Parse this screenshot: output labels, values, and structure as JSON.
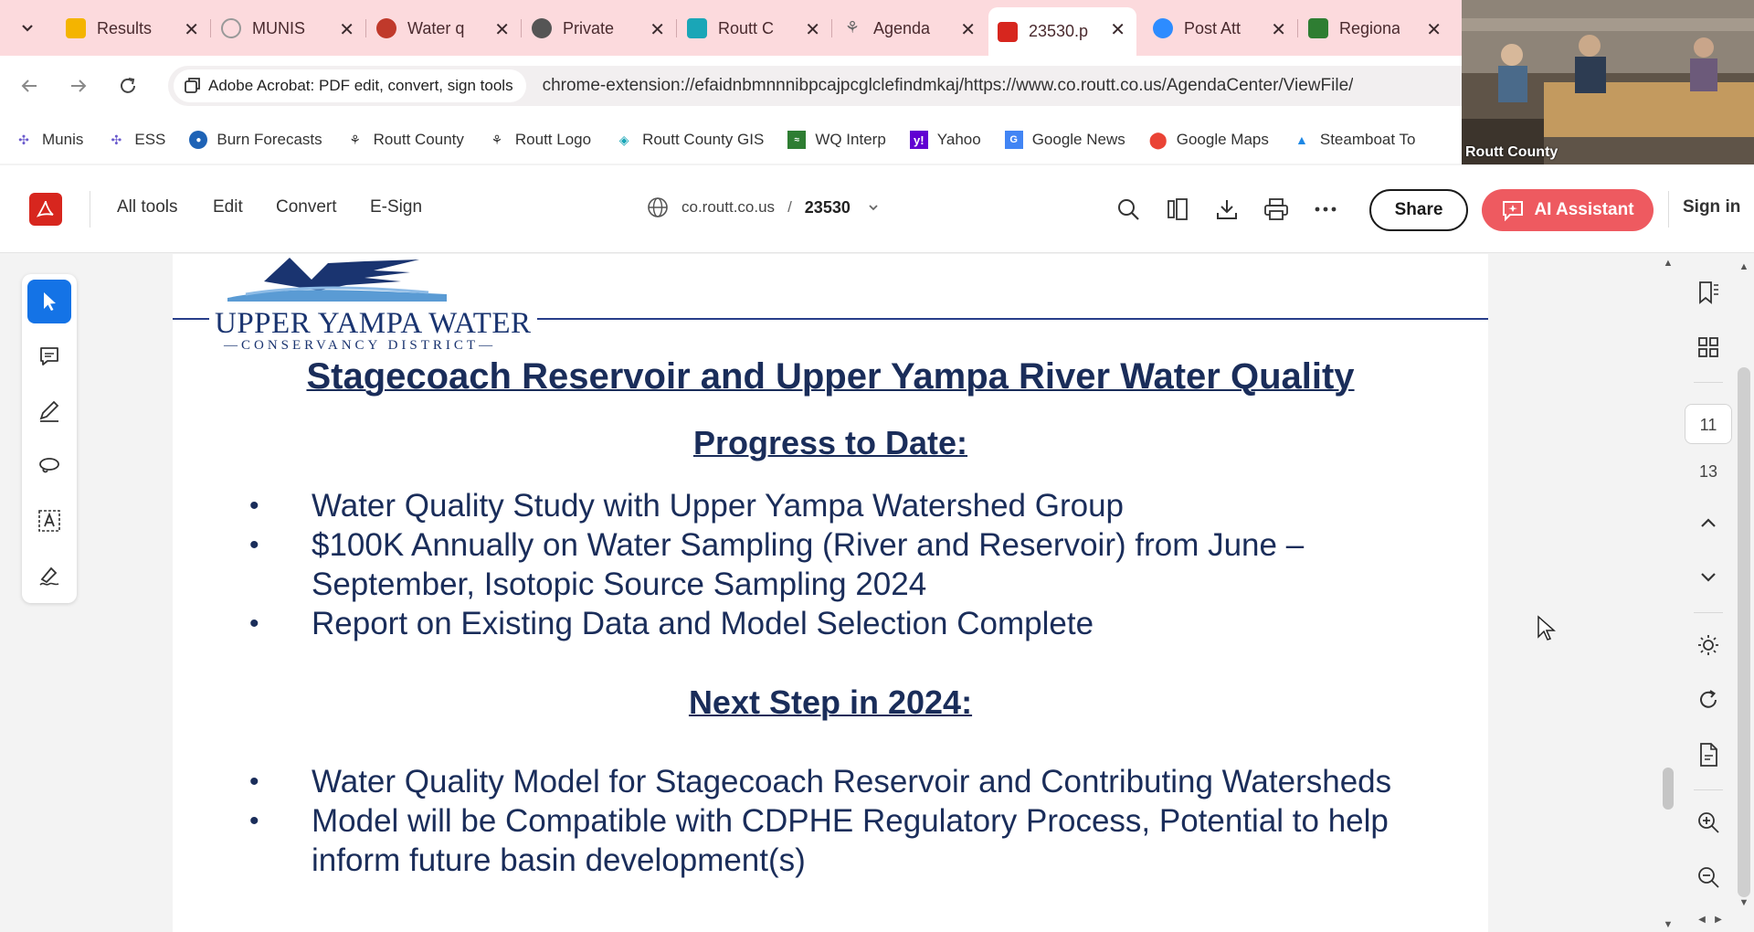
{
  "tabs": [
    {
      "title": "Results",
      "color": "#f4b400"
    },
    {
      "title": "MUNIS",
      "color": "#b0b0b0"
    },
    {
      "title": "Water q",
      "color": "#c0392b"
    },
    {
      "title": "Private",
      "color": "#555555"
    },
    {
      "title": "Routt C",
      "color": "#1aa6b7"
    },
    {
      "title": "Agenda",
      "color": "#666666"
    },
    {
      "title": "23530.p",
      "color": "#d7261e"
    },
    {
      "title": "Post Att",
      "color": "#2d8cff"
    },
    {
      "title": "Regiona",
      "color": "#2e7d32"
    }
  ],
  "address": {
    "chip": "Adobe Acrobat: PDF edit, convert, sign tools",
    "url": "chrome-extension://efaidnbmnnnibpcajpcglclefindmkaj/https://www.co.routt.co.us/AgendaCenter/ViewFile/"
  },
  "bookmarks": [
    {
      "label": "Munis",
      "icon": "munis-icon",
      "color": "#6a5acd"
    },
    {
      "label": "ESS",
      "icon": "ess-icon",
      "color": "#6a5acd"
    },
    {
      "label": "Burn Forecasts",
      "icon": "noaa-icon",
      "color": "#1e63b6"
    },
    {
      "label": "Routt County",
      "icon": "routt-icon",
      "color": "#333333"
    },
    {
      "label": "Routt Logo",
      "icon": "routt-icon",
      "color": "#333333"
    },
    {
      "label": "Routt County GIS",
      "icon": "gis-icon",
      "color": "#1aa6b7"
    },
    {
      "label": "WQ Interp",
      "icon": "wq-icon",
      "color": "#2e7d32"
    },
    {
      "label": "Yahoo",
      "icon": "yahoo-icon",
      "color": "#6001d2"
    },
    {
      "label": "Google News",
      "icon": "google-news-icon",
      "color": "#4285f4"
    },
    {
      "label": "Google Maps",
      "icon": "google-maps-icon",
      "color": "#ea4335"
    },
    {
      "label": "Steamboat To",
      "icon": "steamboat-icon",
      "color": "#1e88e5"
    }
  ],
  "video": {
    "label": "Routt County"
  },
  "acrobat": {
    "menu": [
      "All tools",
      "Edit",
      "Convert",
      "E-Sign"
    ],
    "domain": "co.routt.co.us",
    "separator": "/",
    "filename": "23530",
    "share_label": "Share",
    "ai_label": "AI Assistant",
    "signin_label": "Sign in",
    "accent": "#d7261e",
    "ai_color": "#ee5a60",
    "select_color": "#1473e6"
  },
  "document": {
    "logo_name": "UPPER YAMPA WATER",
    "logo_sub": "—CONSERVANCY DISTRICT—",
    "title": "Stagecoach Reservoir and Upper Yampa River Water Quality",
    "progress_heading": "Progress to Date:",
    "progress_items": [
      "Water Quality Study with Upper Yampa Watershed Group",
      "$100K Annually on Water Sampling (River and Reservoir) from June – September, Isotopic Source Sampling 2024",
      "Report on Existing Data and Model Selection Complete"
    ],
    "next_heading": "Next Step in 2024:",
    "next_items": [
      "Water Quality Model for Stagecoach Reservoir and Contributing Watersheds",
      "Model will be Compatible with CDPHE Regulatory Process, Potential to help inform future basin development(s)"
    ],
    "text_color": "#1a2d5a"
  },
  "pages": {
    "current": "11",
    "next": "13"
  }
}
